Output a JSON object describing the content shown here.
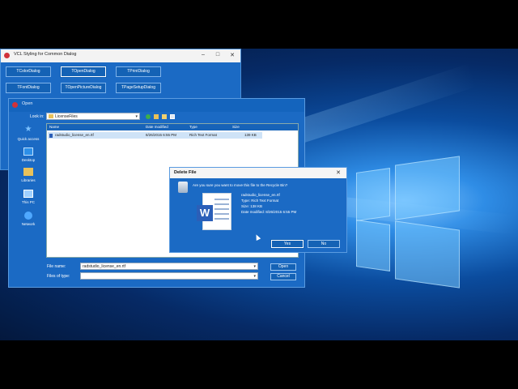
{
  "main_window": {
    "title": "VCL Styling for Common Dialog",
    "buttons": [
      "TColorDialog",
      "TOpenDialog",
      "TPrintDialog",
      "TFontDialog",
      "TOpenPictureDialog",
      "TPageSetupDialog"
    ]
  },
  "open_dialog": {
    "title": "Open",
    "look_in_label": "Look in:",
    "look_in_value": "LicenseFiles",
    "places": [
      "Quick access",
      "Desktop",
      "Libraries",
      "This PC",
      "Network"
    ],
    "columns": [
      "Name",
      "Date modified",
      "Type",
      "Size"
    ],
    "files": [
      {
        "name": "radstudio_license_en.rtf",
        "date": "8/26/2015 6:55 PM",
        "type": "Rich Text Format",
        "size": "139 KB"
      }
    ],
    "file_name_label": "File name:",
    "file_name_value": "radstudio_license_en.rtf",
    "files_of_type_label": "Files of type:",
    "files_of_type_value": "",
    "open_label": "Open",
    "cancel_label": "Cancel"
  },
  "delete_dialog": {
    "title": "Delete File",
    "question": "Are you sure you want to move this file to the Recycle Bin?",
    "file_name": "radstudio_license_en.rtf",
    "file_type": "Type: Rich Text Format",
    "file_size": "Size: 138 KB",
    "file_date": "Date modified: 8/26/2015 6:55 PM",
    "yes_label": "Yes",
    "no_label": "No"
  },
  "colors": {
    "accent": "#1b6ac4",
    "button": "#1462b5",
    "desktop": "#0b4c9e"
  }
}
